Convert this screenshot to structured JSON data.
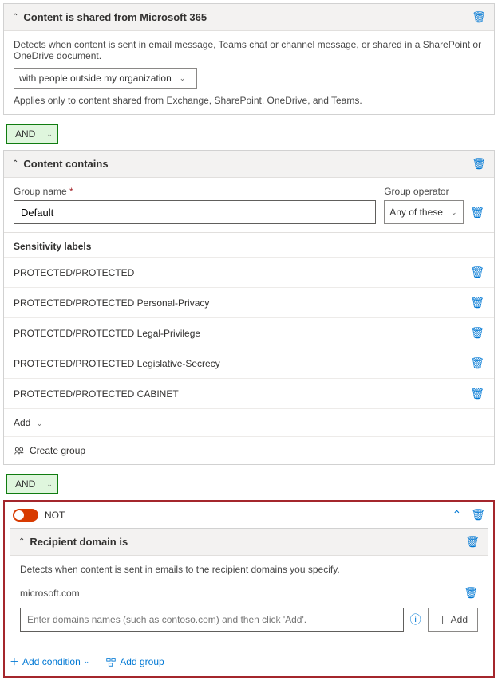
{
  "section1": {
    "title": "Content is shared from Microsoft 365",
    "desc": "Detects when content is sent in email message, Teams chat or channel message, or shared in a SharePoint or OneDrive document.",
    "scope": "with people outside my organization",
    "note": "Applies only to content shared from Exchange, SharePoint, OneDrive, and Teams."
  },
  "operator": {
    "and": "AND"
  },
  "section2": {
    "title": "Content contains",
    "group_name_label": "Group name",
    "group_name_value": "Default",
    "group_op_label": "Group operator",
    "group_op_value": "Any of these",
    "sens_heading": "Sensitivity labels",
    "labels": [
      "PROTECTED/PROTECTED",
      "PROTECTED/PROTECTED Personal-Privacy",
      "PROTECTED/PROTECTED Legal-Privilege",
      "PROTECTED/PROTECTED Legislative-Secrecy",
      "PROTECTED/PROTECTED CABINET"
    ],
    "add": "Add",
    "create": "Create group"
  },
  "notsec": {
    "not_label": "NOT",
    "title": "Recipient domain is",
    "desc": "Detects when content is sent in emails to the recipient domains you specify.",
    "domain": "microsoft.com",
    "placeholder": "Enter domains names (such as contoso.com) and then click 'Add'.",
    "addbtn": "Add",
    "add_condition": "Add condition",
    "add_group": "Add group"
  }
}
